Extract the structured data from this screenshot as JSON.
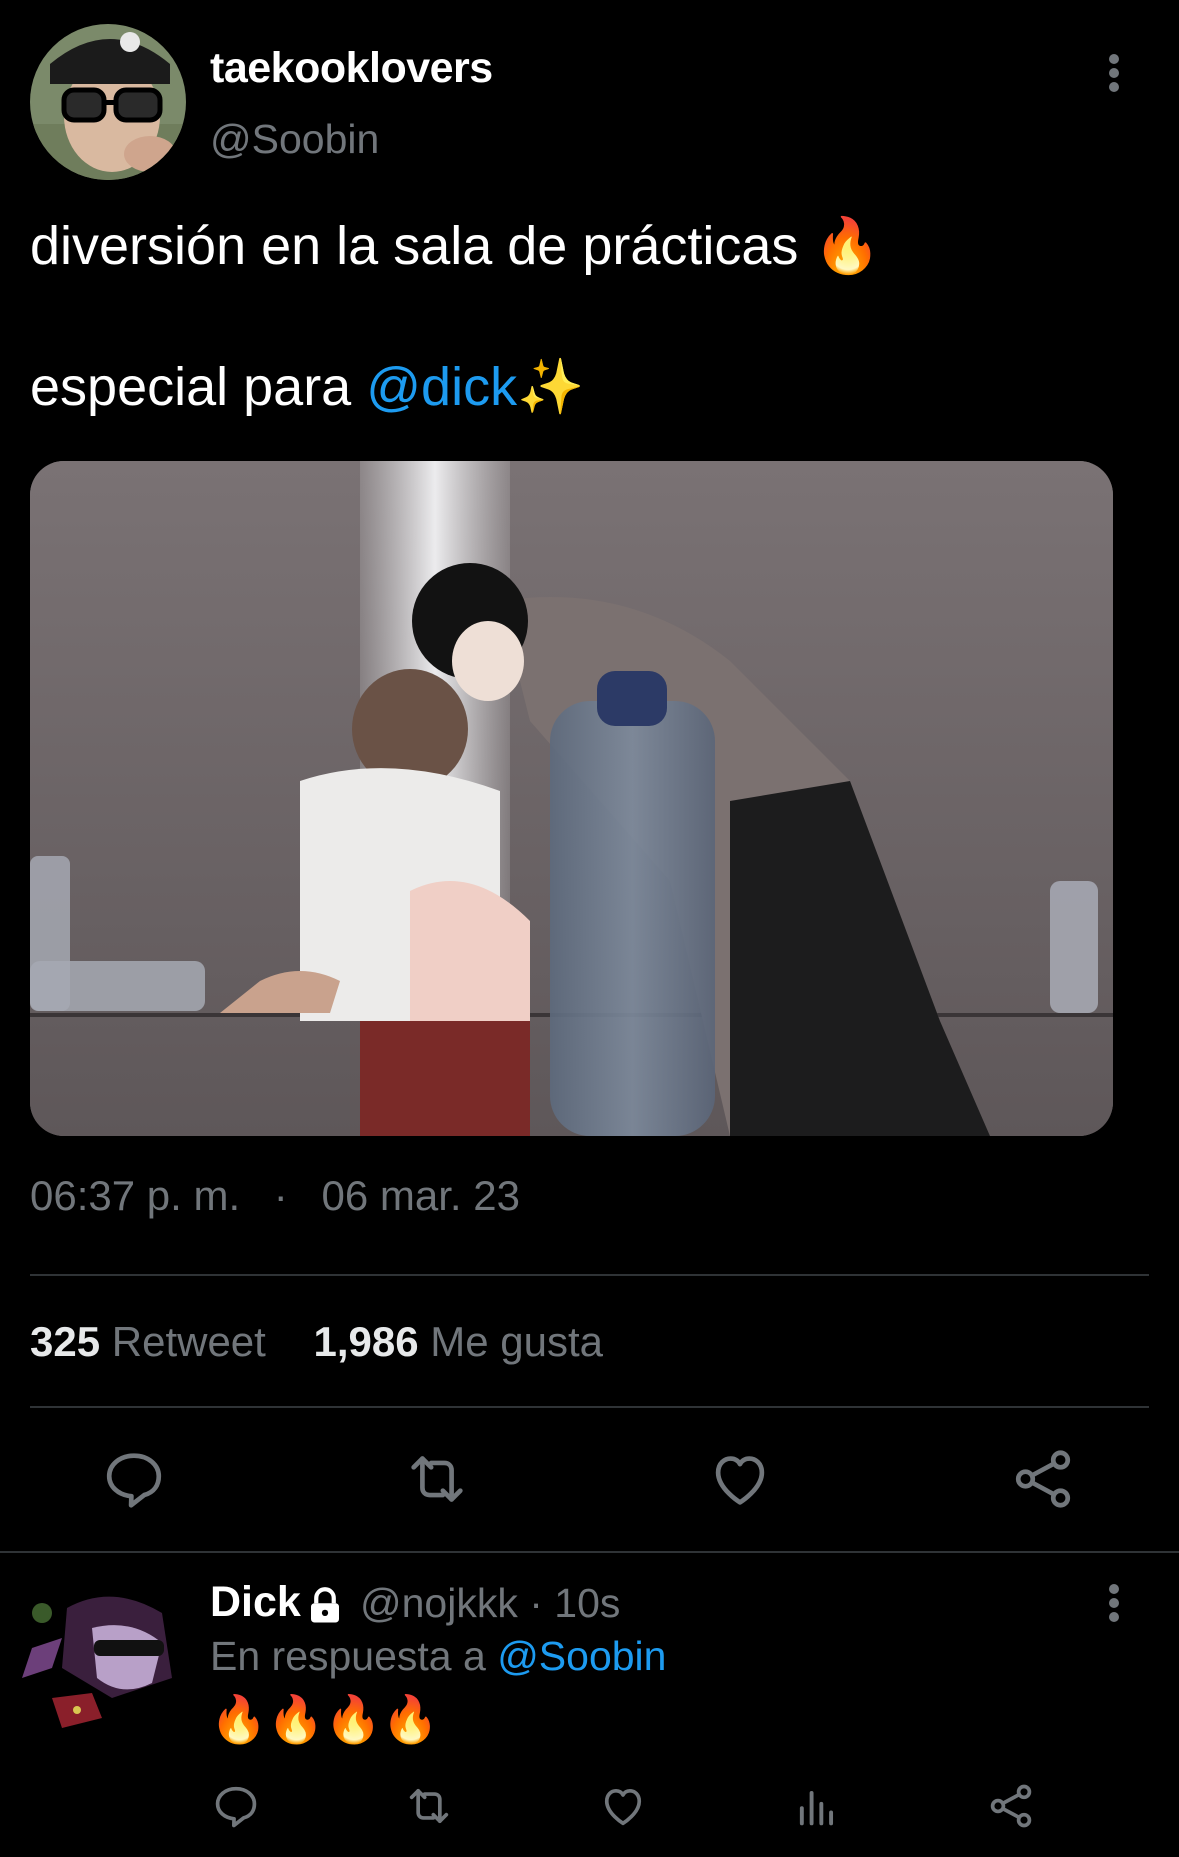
{
  "tweet": {
    "display_name": "taekooklovers",
    "handle": "@Soobin",
    "line1_text": "diversión en la sala de prácticas",
    "line1_emoji": "🔥",
    "line2_text": "especial para ",
    "line2_mention": "@dick",
    "line2_emoji": "✨",
    "time": "06:37 p. m.",
    "separator": "·",
    "date": "06 mar. 23",
    "retweets_count": "325",
    "retweets_label": "Retweet",
    "likes_count": "1,986",
    "likes_label": "Me gusta"
  },
  "reply": {
    "display_name": "Dick",
    "handle_time": "@nojkkk · 10s",
    "replying_prefix": "En respuesta a ",
    "replying_mention": "@Soobin",
    "text": "🔥🔥🔥🔥"
  },
  "icons": {
    "more": "more-vertical-icon",
    "reply": "reply-icon",
    "retweet": "retweet-icon",
    "like": "heart-icon",
    "share": "share-icon",
    "views": "views-icon",
    "lock": "lock-icon"
  },
  "colors": {
    "background": "#000000",
    "text": "#e7e9ea",
    "secondary": "#71767b",
    "link": "#1d9bf0",
    "divider": "#2f3336"
  }
}
